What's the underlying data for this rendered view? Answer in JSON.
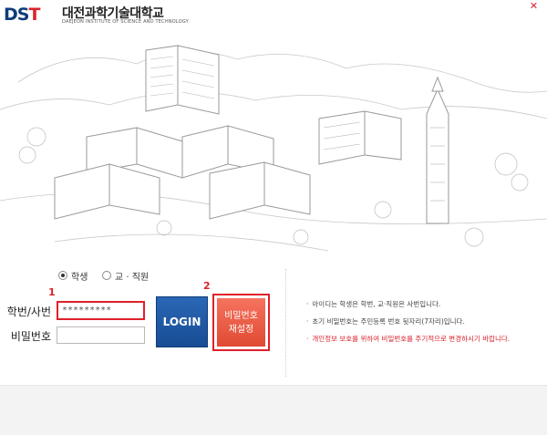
{
  "header": {
    "logo_mark": "DST",
    "school_name_kr": "대전과학기술대학교",
    "school_name_en": "DAEJEON INSTITUTE OF SCIENCE AND TECHNOLOGY",
    "close_icon": "close-icon"
  },
  "illustration": {
    "icon": "campus-illustration"
  },
  "login": {
    "role_options": [
      {
        "label": "학생",
        "selected": true
      },
      {
        "label": "교 · 직원",
        "selected": false
      }
    ],
    "id_label": "학번/사번",
    "id_value": "*********",
    "password_label": "비밀번호",
    "password_value": "",
    "login_button": "LOGIN",
    "reset_button_line1": "비밀번호",
    "reset_button_line2": "재설정",
    "marker_1": "1",
    "marker_2": "2"
  },
  "notices": [
    {
      "text": "아이디는 학생은 학번, 교·직원은 사번입니다.",
      "warn": false
    },
    {
      "text": "초기 비밀번호는 주민등록 번호 뒷자리(7자리)입니다.",
      "warn": false
    },
    {
      "text": "개인정보 보호를 위하여 비밀번호를 주기적으로 변경하시기 바랍니다.",
      "warn": true
    }
  ],
  "colors": {
    "brand_blue": "#0f3c7a",
    "accent_red": "#d9232d",
    "login_blue": "#1f5aa6",
    "reset_orange": "#e8573f"
  }
}
